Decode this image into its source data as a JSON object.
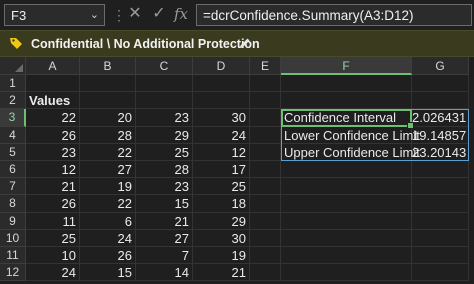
{
  "formula_bar": {
    "name_box": "F3",
    "formula": "=dcrConfidence.Summary(A3:D12)"
  },
  "sensitivity_bar": {
    "label": "Confidential \\ No Additional Protection",
    "accent": "#f2c811"
  },
  "columns": [
    "A",
    "B",
    "C",
    "D",
    "E",
    "F",
    "G"
  ],
  "rows": [
    "1",
    "2",
    "3",
    "4",
    "5",
    "6",
    "7",
    "8",
    "9",
    "10",
    "11",
    "12"
  ],
  "header_label": "Values",
  "values": [
    [
      "22",
      "20",
      "23",
      "30"
    ],
    [
      "26",
      "28",
      "29",
      "24"
    ],
    [
      "23",
      "22",
      "25",
      "12"
    ],
    [
      "12",
      "27",
      "28",
      "17"
    ],
    [
      "21",
      "19",
      "23",
      "25"
    ],
    [
      "26",
      "22",
      "15",
      "18"
    ],
    [
      "11",
      "6",
      "21",
      "29"
    ],
    [
      "25",
      "24",
      "27",
      "30"
    ],
    [
      "10",
      "26",
      "7",
      "19"
    ],
    [
      "24",
      "15",
      "14",
      "21"
    ]
  ],
  "summary": [
    {
      "label": "Confidence Interval",
      "value": "2.026431"
    },
    {
      "label": "Lower Confidence Limit",
      "value": "19.14857"
    },
    {
      "label": "Upper Confidence Limit",
      "value": "23.20143"
    }
  ],
  "colors": {
    "selection": "#6fbf73",
    "stat_border": "#5aa0d0"
  }
}
